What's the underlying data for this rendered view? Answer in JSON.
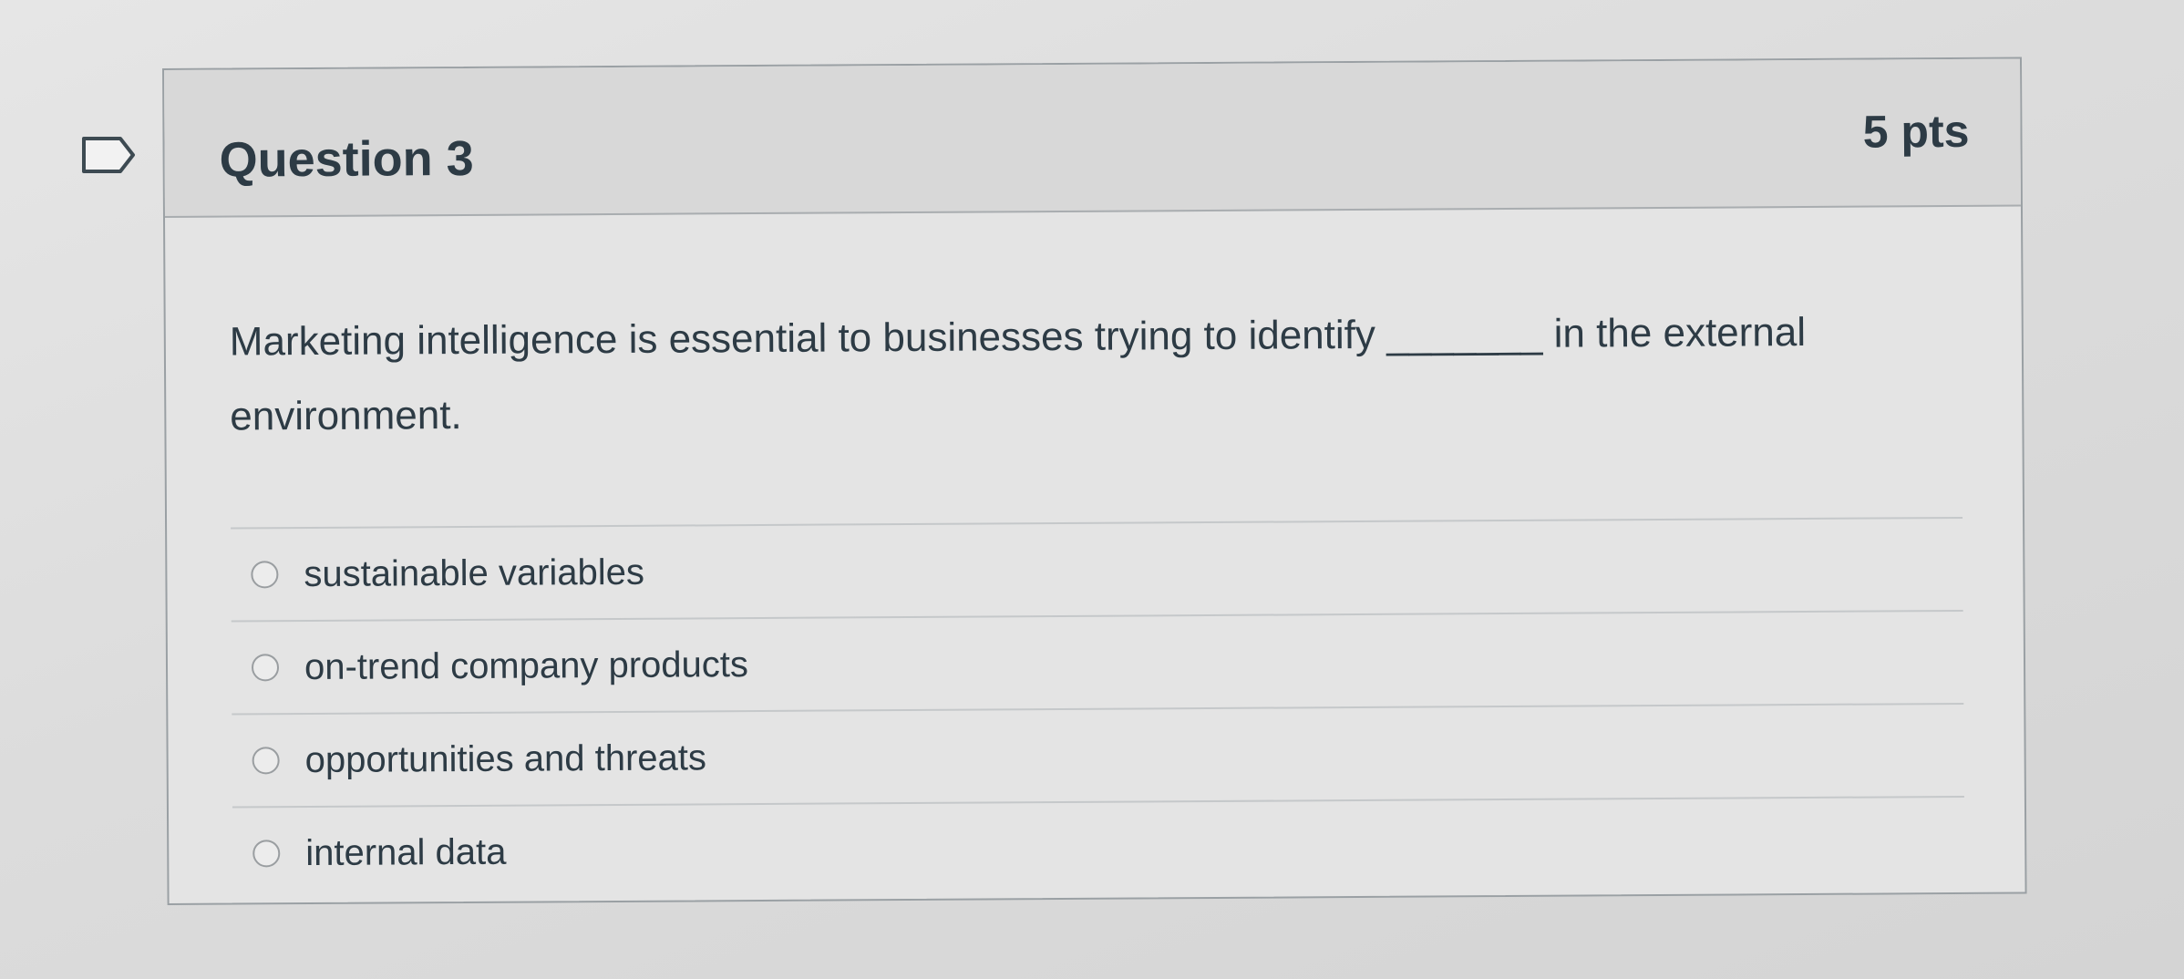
{
  "question": {
    "title": "Question 3",
    "points": "5 pts",
    "text": "Marketing intelligence is essential to businesses trying to identify _______ in the external environment."
  },
  "answers": [
    {
      "label": "sustainable variables"
    },
    {
      "label": "on-trend company products"
    },
    {
      "label": "opportunities and threats"
    },
    {
      "label": "internal data"
    }
  ],
  "icons": {
    "flag": "flag-question-icon",
    "radio": "radio-button-icon"
  }
}
